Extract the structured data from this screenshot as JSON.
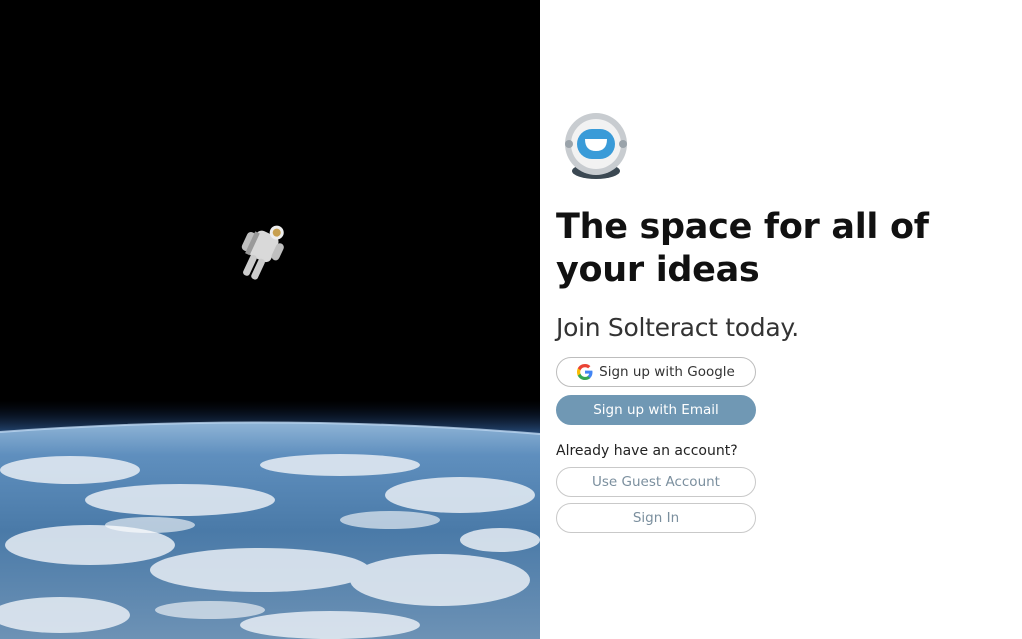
{
  "hero": {
    "image": "astronaut-floating-above-earth"
  },
  "brand": {
    "logo": "astronaut-helmet-logo",
    "accent_color": "#7098b4"
  },
  "content": {
    "headline": "The space for all of your ideas",
    "subhead": "Join Solteract today."
  },
  "signup": {
    "google_label": "Sign up with Google",
    "google_icon": "google-g-icon",
    "email_label": "Sign up with Email"
  },
  "login": {
    "prompt": "Already have an account?",
    "guest_label": "Use Guest Account",
    "signin_label": "Sign In"
  }
}
